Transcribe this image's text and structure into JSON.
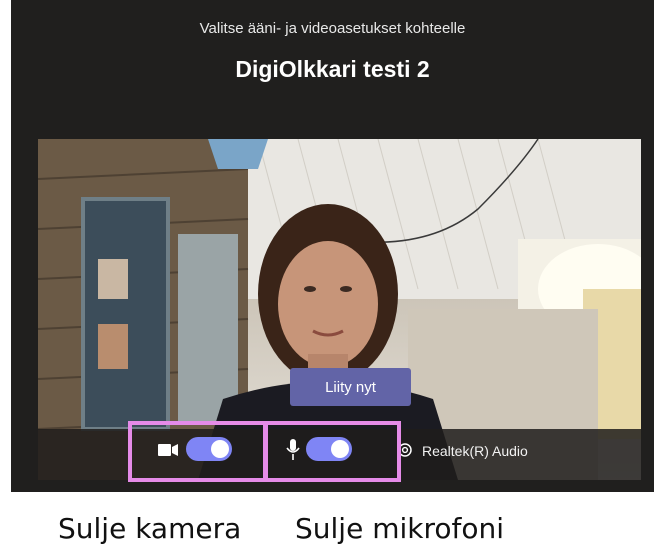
{
  "header": {
    "subtitle": "Valitse ääni- ja videoasetukset kohteelle",
    "meeting_title": "DigiOlkkari testi 2"
  },
  "preview": {
    "join_button": "Liity nyt",
    "camera_toggle_on": true,
    "mic_toggle_on": true,
    "audio_device": "Realtek(R) Audio"
  },
  "captions": {
    "camera": "Sulje kamera",
    "microphone": "Sulje mikrofoni"
  },
  "colors": {
    "accent": "#6264a7",
    "highlight": "#e58be8"
  }
}
